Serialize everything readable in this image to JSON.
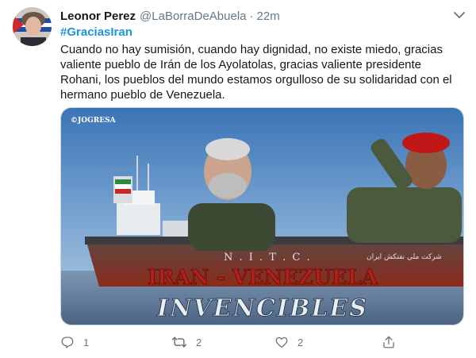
{
  "tweet": {
    "author_name": "Leonor Perez",
    "author_handle": "@LaBorraDeAbuela",
    "separator": "·",
    "timestamp": "22m",
    "hashtag": "#GraciasIran",
    "text": "Cuando no hay sumisión, cuando hay dignidad, no existe miedo, gracias valiente pueblo de Irán de los Ayolatolas, gracias valiente presidente Rohani, los pueblos del mundo estamos orgulloso de su solidaridad con el hermano pueblo de Venezuela."
  },
  "media": {
    "watermark": "©JOGRESA",
    "ship_hull_text": "N . I . T . C .",
    "ship_arabic_text": "شركت ملي نفتكش ايران",
    "banner_text": "IRAN - VENEZUELA",
    "slogan_text": "INVENCIBLES"
  },
  "actions": {
    "reply_count": "1",
    "retweet_count": "2",
    "like_count": "2"
  },
  "colors": {
    "accent": "#1b95e0",
    "muted": "#657786",
    "banner_red": "#b3201a"
  }
}
